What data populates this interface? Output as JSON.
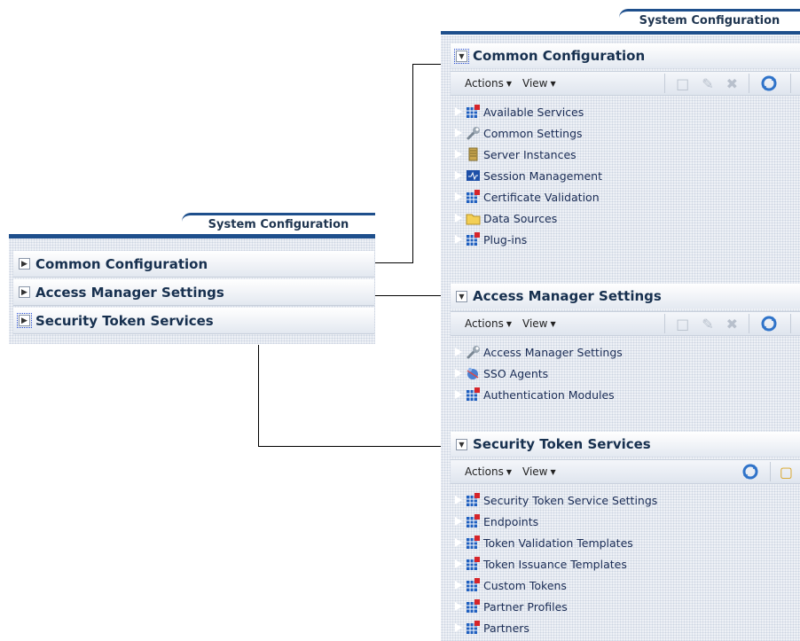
{
  "small_panel": {
    "tab_label": "System Configuration",
    "items": [
      {
        "label": "Common Configuration"
      },
      {
        "label": "Access Manager Settings"
      },
      {
        "label": "Security Token Services"
      }
    ]
  },
  "large_panel": {
    "tab_label": "System Configuration",
    "sections": [
      {
        "title": "Common Configuration",
        "actions_label": "Actions",
        "view_label": "View",
        "nodes": [
          {
            "label": "Available Services",
            "icon": "grid-icon"
          },
          {
            "label": "Common Settings",
            "icon": "wrench-icon"
          },
          {
            "label": "Server Instances",
            "icon": "server-icon"
          },
          {
            "label": "Session Management",
            "icon": "session-icon"
          },
          {
            "label": "Certificate Validation",
            "icon": "grid-icon"
          },
          {
            "label": "Data Sources",
            "icon": "folder-icon"
          },
          {
            "label": "Plug-ins",
            "icon": "grid-icon"
          }
        ]
      },
      {
        "title": "Access Manager Settings",
        "actions_label": "Actions",
        "view_label": "View",
        "nodes": [
          {
            "label": "Access Manager Settings",
            "icon": "wrench-icon"
          },
          {
            "label": "SSO Agents",
            "icon": "agent-icon"
          },
          {
            "label": "Authentication Modules",
            "icon": "grid-icon"
          }
        ]
      },
      {
        "title": "Security Token Services",
        "actions_label": "Actions",
        "view_label": "View",
        "nodes": [
          {
            "label": "Security Token Service Settings",
            "icon": "grid-icon"
          },
          {
            "label": "Endpoints",
            "icon": "grid-icon"
          },
          {
            "label": "Token Validation Templates",
            "icon": "grid-icon"
          },
          {
            "label": "Token Issuance Templates",
            "icon": "grid-icon"
          },
          {
            "label": "Custom Tokens",
            "icon": "grid-icon"
          },
          {
            "label": "Partner Profiles",
            "icon": "grid-icon"
          },
          {
            "label": "Partners",
            "icon": "grid-icon"
          }
        ]
      }
    ]
  },
  "colors": {
    "accent": "#1e4f8c",
    "text": "#17304f"
  }
}
